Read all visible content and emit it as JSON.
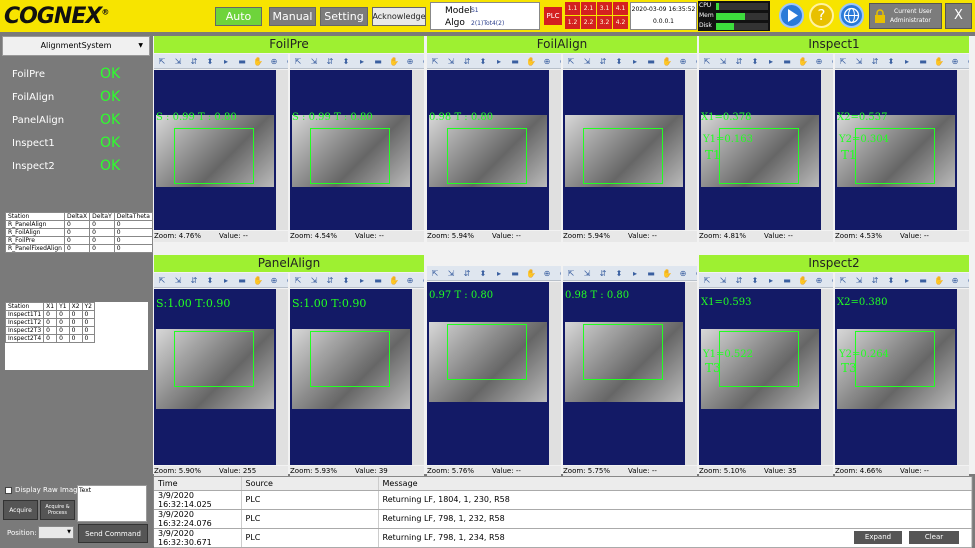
{
  "app": {
    "logo": "COGNEX",
    "logo_mark": "®"
  },
  "modes": {
    "auto": "Auto",
    "manual": "Manual",
    "setting": "Setting",
    "acknowledge": "Acknowledge"
  },
  "model_box": {
    "model_label": "Model",
    "model_value": "S1",
    "algo_label": "Algo",
    "algo_value": "2(1)Tot4(2)"
  },
  "plc": {
    "label": "PLC",
    "leds": [
      "1.1",
      "2.1",
      "3.1",
      "4.1",
      "1.2",
      "2.2",
      "3.2",
      "4.2",
      "1.3",
      "2.3",
      "3.3",
      "4.3"
    ]
  },
  "datetime": {
    "date": "2020-03-09 16:35:52",
    "version": "0.0.0.1"
  },
  "resources": {
    "cpu_label": "CPU",
    "mem_label": "Mem",
    "disk_label": "Disk",
    "cpu": 0.05,
    "mem": 0.55,
    "disk": 0.35
  },
  "user": {
    "label": "Current User",
    "name": "Administrator"
  },
  "close": "X",
  "left": {
    "system_select": "AlignmentSystem",
    "status": [
      {
        "name": "FoilPre",
        "value": "OK"
      },
      {
        "name": "FoilAlign",
        "value": "OK"
      },
      {
        "name": "PanelAlign",
        "value": "OK"
      },
      {
        "name": "Inspect1",
        "value": "OK"
      },
      {
        "name": "Inspect2",
        "value": "OK"
      }
    ],
    "table1": {
      "headers": [
        "Station",
        "DeltaX",
        "DeltaY",
        "DeltaTheta",
        "Ta"
      ],
      "rows": [
        [
          "R_PanelAlign",
          "0",
          "0",
          "0",
          "0"
        ],
        [
          "R_FoilAlign",
          "0",
          "0",
          "0",
          "0"
        ],
        [
          "R_FoilPre",
          "0",
          "0",
          "0",
          "0"
        ],
        [
          "R_PanelFixedAlign",
          "0",
          "0",
          "0",
          "0"
        ]
      ]
    },
    "table2": {
      "headers": [
        "Station",
        "X1",
        "Y1",
        "X2",
        "Y2"
      ],
      "rows": [
        [
          "Inspect1T1",
          "0",
          "0",
          "0",
          "0"
        ],
        [
          "Inspect1T2",
          "0",
          "0",
          "0",
          "0"
        ],
        [
          "Inspect2T3",
          "0",
          "0",
          "0",
          "0"
        ],
        [
          "Inspect2T4",
          "0",
          "0",
          "0",
          "0"
        ]
      ]
    },
    "raw_image_label": "Display Raw Image",
    "text_label": "Text",
    "acquire": "Acquire",
    "acquire_process": "Acquire & Process",
    "position_label": "Position:",
    "send_command": "Send Command"
  },
  "groups": [
    {
      "title": "FoilPre"
    },
    {
      "title": "FoilAlign"
    },
    {
      "title": "Inspect1"
    },
    {
      "title": "PanelAlign"
    },
    {
      "title": "Inspect2"
    }
  ],
  "cams": [
    {
      "zoom": "Zoom: 4.76%",
      "value": "Value: --",
      "overlay": "S : 0.99 T : 0.80"
    },
    {
      "zoom": "Zoom: 4.54%",
      "value": "Value: --",
      "overlay": "S : 0.99 T : 0.80"
    },
    {
      "zoom": "Zoom: 5.94%",
      "value": "Value: --",
      "overlay": "0.98 T : 0.80"
    },
    {
      "zoom": "Zoom: 5.94%",
      "value": "Value: --",
      "overlay": ""
    },
    {
      "zoom": "Zoom: 4.81%",
      "value": "Value: --",
      "overlay": "X1=0.378",
      "overlay2": "Y1=0.163",
      "tag": "T1"
    },
    {
      "zoom": "Zoom: 4.53%",
      "value": "Value: --",
      "overlay": "X2=0.537",
      "overlay2": "Y2=0.304",
      "tag": "T1"
    },
    {
      "zoom": "Zoom: 5.90%",
      "value": "Value: 255",
      "overlay": "S:1.00 T:0.90"
    },
    {
      "zoom": "Zoom: 5.93%",
      "value": "Value: 39",
      "overlay": "S:1.00 T:0.90"
    },
    {
      "zoom": "Zoom: 5.76%",
      "value": "Value: --",
      "overlay": "0.97 T : 0.80"
    },
    {
      "zoom": "Zoom: 5.75%",
      "value": "Value: --",
      "overlay": "0.98 T : 0.80"
    },
    {
      "zoom": "Zoom: 5.10%",
      "value": "Value: 35",
      "overlay": "X1=0.593",
      "overlay2": "Y1=0.522",
      "tag": "T3"
    },
    {
      "zoom": "Zoom: 4.66%",
      "value": "Value: --",
      "overlay": "X2=0.380",
      "overlay2": "Y2=0.264",
      "tag": "T3"
    }
  ],
  "log": {
    "headers": [
      "Time",
      "Source",
      "Message"
    ],
    "rows": [
      [
        "3/9/2020 16:32:14.025",
        "PLC",
        "Returning LF, 1804, 1, 230, R58"
      ],
      [
        "3/9/2020 16:32:24.076",
        "PLC",
        "Returning LF, 798, 1, 232, R58"
      ],
      [
        "3/9/2020 16:32:30.671",
        "PLC",
        "Returning LF, 798, 1, 234, R58"
      ]
    ],
    "expand": "Expand",
    "clear": "Clear"
  }
}
